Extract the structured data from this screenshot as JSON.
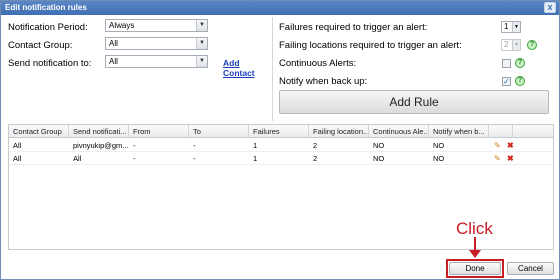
{
  "dialog": {
    "title": "Edit notification rules",
    "close_glyph": "x"
  },
  "form": {
    "notification_period": {
      "label": "Notification Period:",
      "value": "Always"
    },
    "contact_group": {
      "label": "Contact Group:",
      "value": "All"
    },
    "send_to": {
      "label": "Send notification to:",
      "value": "All"
    },
    "add_contact": "Add Contact",
    "failures": {
      "label": "Failures required to trigger an alert:",
      "value": "1"
    },
    "failing_locations": {
      "label": "Failing locations required to trigger an alert:",
      "value": "2"
    },
    "continuous_alerts": {
      "label": "Continuous Alerts:",
      "checked": false
    },
    "notify_back_up": {
      "label": "Notify when back up:",
      "checked": true
    },
    "add_rule": "Add Rule",
    "check_glyph": "✓",
    "help_glyph": "?",
    "dropdown_glyph": "▼"
  },
  "grid": {
    "columns": [
      "Contact Group",
      "Send notificati...",
      "From",
      "To",
      "Failures",
      "Failing location...",
      "Continuous Ale...",
      "Notify when b..."
    ],
    "rows": [
      [
        "All",
        "pivnyukip@gm...",
        "-",
        "-",
        "1",
        "2",
        "NO",
        "NO"
      ],
      [
        "All",
        "All",
        "-",
        "-",
        "1",
        "2",
        "NO",
        "NO"
      ]
    ],
    "edit_glyph": "✎",
    "delete_glyph": "✖"
  },
  "buttons": {
    "done": "Done",
    "cancel": "Cancel"
  },
  "annotation": {
    "text": "Click",
    "color": "#c81d25"
  },
  "colors": {
    "titlebar": "#4a7bbf",
    "link": "#1a3fb8",
    "accent_red": "#c81d25"
  }
}
